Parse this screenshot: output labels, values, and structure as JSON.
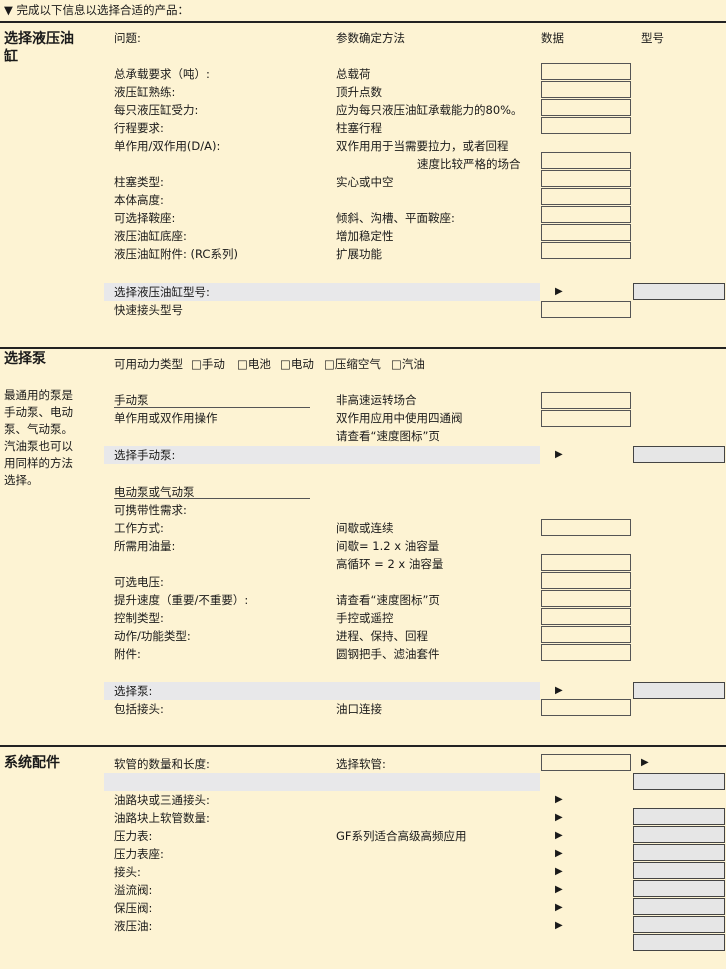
{
  "header": "▼ 完成以下信息以选择合适的产品：",
  "cols": {
    "question": "问题:",
    "method": "参数确定方法",
    "data": "数据",
    "model": "型号"
  },
  "cyl": {
    "title": "选择液压油缸",
    "rows": [
      {
        "q": "总承载要求（吨）:",
        "m": "总载荷"
      },
      {
        "q": "液压缸熟练:",
        "m": "顶升点数"
      },
      {
        "q": "每只液压缸受力:",
        "m": "应为每只液压油缸承载能力的80%。"
      },
      {
        "q": "行程要求:",
        "m": "柱塞行程"
      },
      {
        "q": "单作用/双作用(D/A):",
        "m": "双作用用于当需要拉力，或者回程"
      },
      {
        "q": "",
        "m": "速度比较严格的场合"
      },
      {
        "q": "柱塞类型:",
        "m": "实心或中空"
      },
      {
        "q": "本体高度:",
        "m": ""
      },
      {
        "q": "可选择鞍座:",
        "m": "倾斜、沟槽、平面鞍座:"
      },
      {
        "q": "液压油缸底座:",
        "m": "增加稳定性"
      },
      {
        "q": "液压油缸附件: (RC系列)",
        "m": "扩展功能"
      }
    ],
    "select": "选择液压油缸型号:",
    "coupler": "快速接头型号"
  },
  "pump": {
    "title": "选择泵",
    "note": "最通用的泵是手动泵、电动泵、气动泵。汽油泵也可以用同样的方法选择。",
    "power_label": "可用动力类型",
    "power_options": [
      "□手动",
      "□电池",
      "□电动",
      "□压缩空气",
      "□汽油"
    ],
    "manual_heading": "手动泵",
    "manual_rows": [
      {
        "q": "",
        "m": "非高速运转场合"
      },
      {
        "q": "单作用或双作用操作",
        "m": "双作用应用中使用四通阀"
      },
      {
        "q": "",
        "m": "请查看“速度图标”页"
      }
    ],
    "manual_select": "选择手动泵:",
    "elec_heading": "电动泵或气动泵",
    "elec_rows": [
      {
        "q": "可携带性需求:",
        "m": ""
      },
      {
        "q": "工作方式:",
        "m": "间歇或连续"
      },
      {
        "q": "所需用油量:",
        "m": "间歇= 1.2 x 油容量"
      },
      {
        "q": "",
        "m": "高循环 = 2 x 油容量"
      },
      {
        "q": "可选电压:",
        "m": ""
      },
      {
        "q": "提升速度（重要/不重要）:",
        "m": "请查看“速度图标”页"
      },
      {
        "q": "控制类型:",
        "m": "手控或遥控"
      },
      {
        "q": "动作/功能类型:",
        "m": "进程、保持、回程"
      },
      {
        "q": "附件:",
        "m": "圆钢把手、滤油套件"
      }
    ],
    "select": "选择泵:",
    "fitting_q": "包括接头:",
    "fitting_m": "油口连接"
  },
  "sys": {
    "title": "系统配件",
    "hose_q": "软管的数量和长度:",
    "hose_m": "选择软管:",
    "rows": [
      {
        "q": "油路块或三通接头:",
        "m": ""
      },
      {
        "q": "油路块上软管数量:",
        "m": ""
      },
      {
        "q": "压力表:",
        "m": "GF系列适合高级高频应用"
      },
      {
        "q": "压力表座:",
        "m": ""
      },
      {
        "q": "接头:",
        "m": ""
      },
      {
        "q": "溢流阀:",
        "m": ""
      },
      {
        "q": "保压阀:",
        "m": ""
      },
      {
        "q": "液压油:",
        "m": ""
      }
    ]
  },
  "arrow_glyph": "▶"
}
